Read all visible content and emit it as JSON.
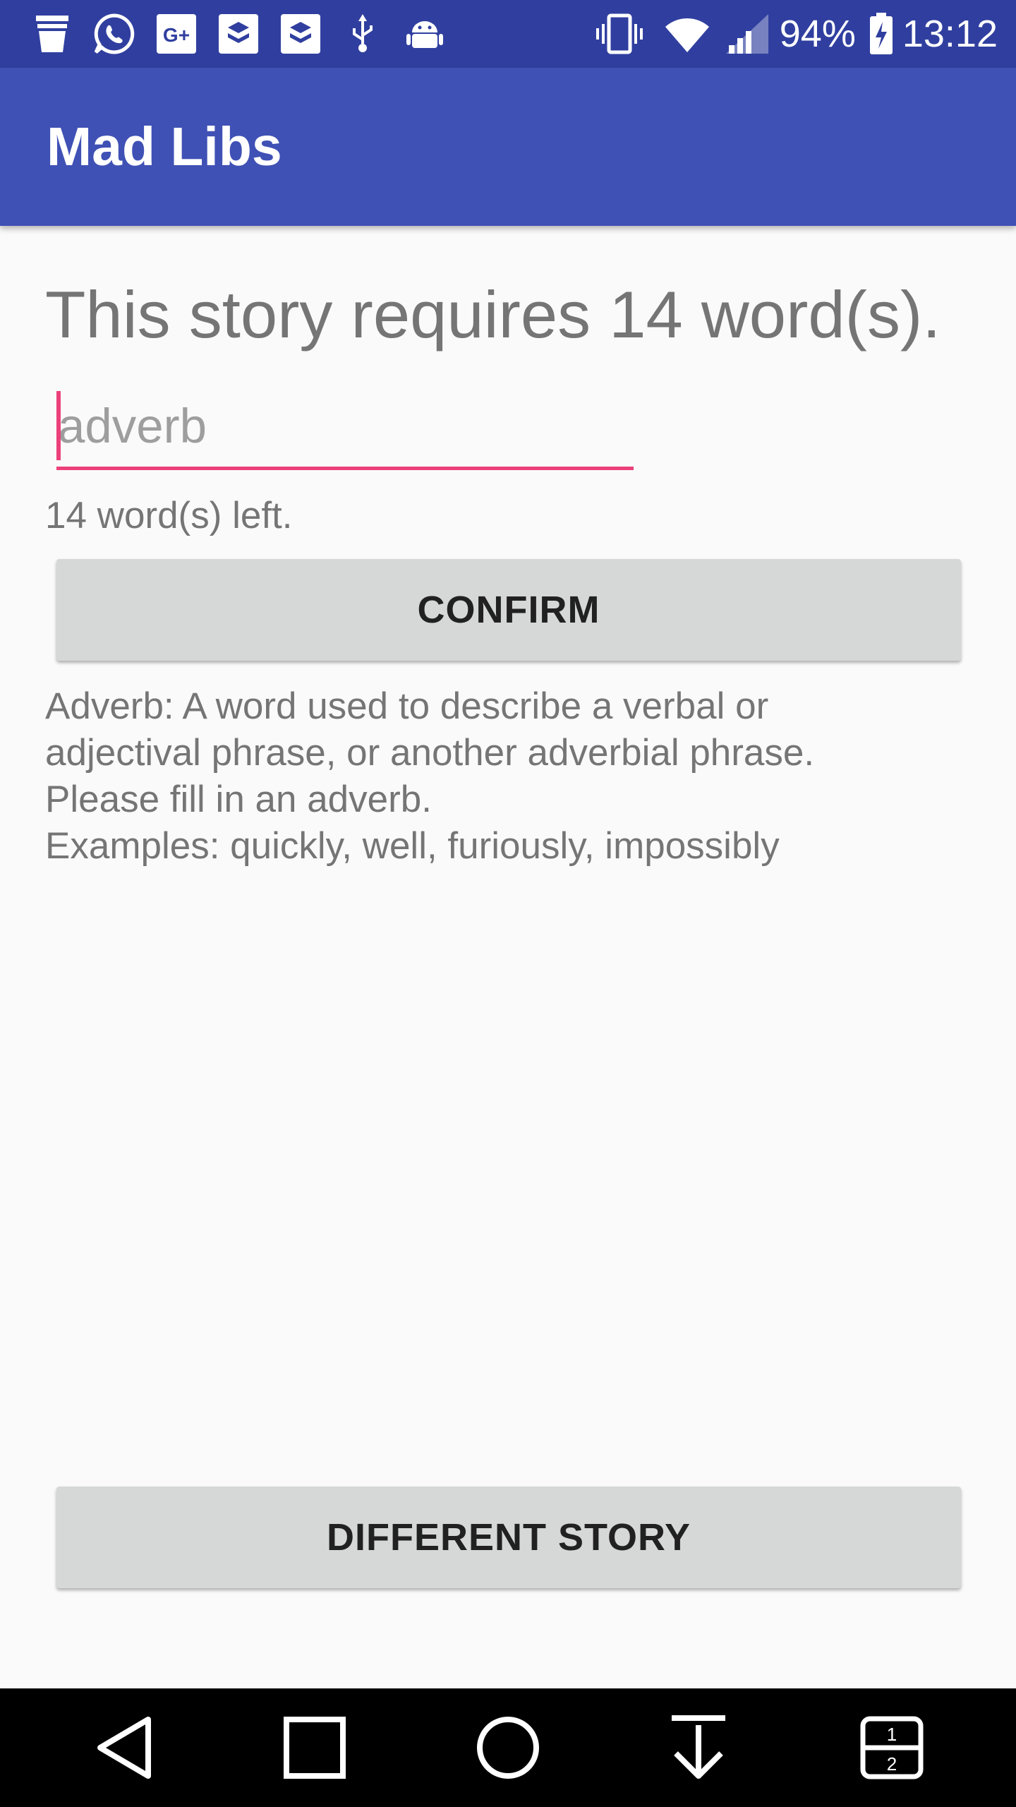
{
  "status_bar": {
    "left_icons": [
      "cup-icon",
      "whatsapp-icon",
      "google-plus-icon",
      "app-icon",
      "app-icon",
      "usb-icon",
      "android-icon"
    ],
    "right_icons": [
      "vibrate-icon",
      "wifi-icon",
      "signal-icon"
    ],
    "battery_percent": "94%",
    "time": "13:12"
  },
  "app_bar": {
    "title": "Mad Libs"
  },
  "main": {
    "heading": "This story requires 14 word(s).",
    "input": {
      "value": "",
      "placeholder": "adverb"
    },
    "words_left": "14 word(s) left.",
    "confirm_label": "CONFIRM",
    "description_lines": [
      "Adverb: A word used to describe a verbal or",
      "adjectival phrase, or another adverbial phrase.",
      "Please fill in an adverb.",
      "Examples: quickly, well, furiously, impossibly"
    ],
    "different_story_label": "DIFFERENT STORY"
  },
  "nav_bar": {
    "icons": [
      "back-icon",
      "recents-icon",
      "home-icon",
      "notification-pull-icon",
      "dual-window-icon"
    ]
  },
  "colors": {
    "status_bar": "#303f9f",
    "app_bar": "#3f51b5",
    "accent": "#ec407a",
    "button_bg": "#d6d7d7",
    "text_secondary": "#757575"
  }
}
